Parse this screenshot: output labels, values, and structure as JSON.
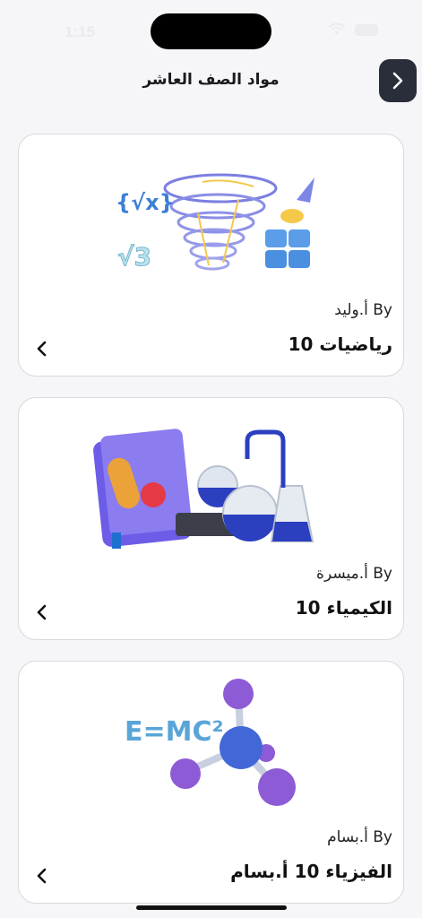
{
  "status_bar": {
    "time": "1:15"
  },
  "header": {
    "title": "مواد الصف العاشر",
    "back_icon": "chevron-right-icon"
  },
  "courses": [
    {
      "title": "رياضيات 10",
      "author": "By أ.وليد",
      "illustration": "math-tornado-illustration",
      "illustration_text": [
        "{√x}",
        "√3"
      ],
      "chevron": "chevron-left-icon"
    },
    {
      "title": "الكيمياء 10",
      "author": "By أ.ميسرة",
      "illustration": "chemistry-flasks-illustration",
      "chevron": "chevron-left-icon"
    },
    {
      "title": "الفيزياء 10 أ.بسام",
      "author": "By أ.بسام",
      "illustration": "physics-molecule-illustration",
      "illustration_text": [
        "E=MC²"
      ],
      "chevron": "chevron-left-icon"
    }
  ],
  "colors": {
    "background": "#f6f6f8",
    "card_border": "#d9d9de",
    "back_button": "#2a2d3a"
  }
}
